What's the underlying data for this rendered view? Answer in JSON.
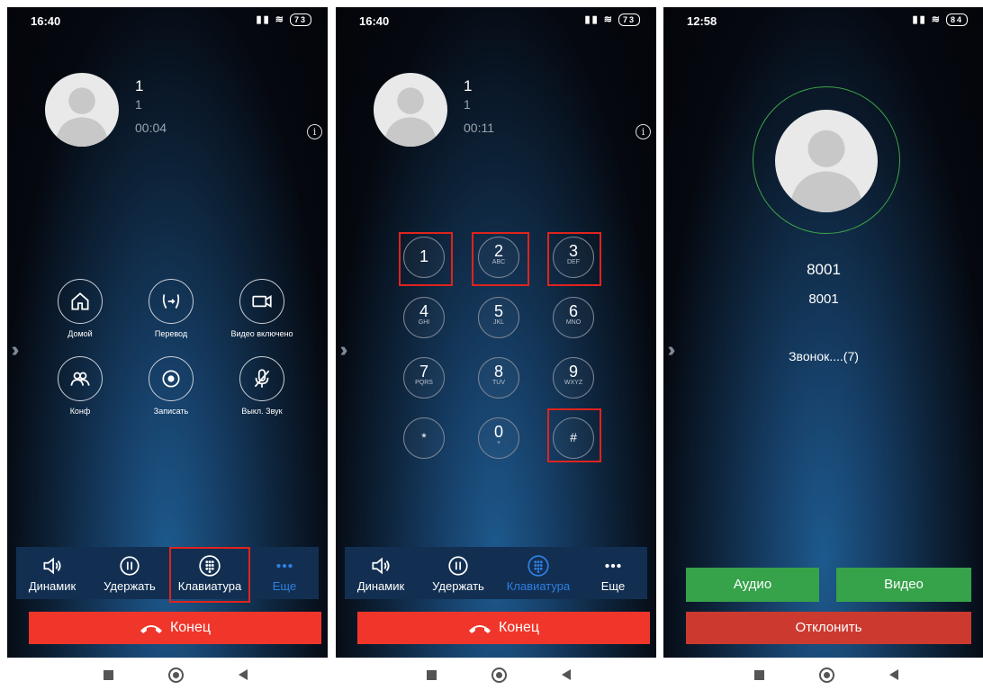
{
  "screens": [
    {
      "status_time": "16:40",
      "battery": "73",
      "caller_name": "1",
      "caller_number": "1",
      "duration": "00:04",
      "actions": [
        {
          "label": "Домой",
          "icon": "home-icon"
        },
        {
          "label": "Перевод",
          "icon": "transfer-icon"
        },
        {
          "label": "Видео включено",
          "icon": "video-icon"
        },
        {
          "label": "Конф",
          "icon": "conference-icon"
        },
        {
          "label": "Записать",
          "icon": "record-icon"
        },
        {
          "label": "Выкл. Звук",
          "icon": "mute-icon"
        }
      ],
      "bottom": [
        "Динамик",
        "Удержать",
        "Клавиатура",
        "Еще"
      ],
      "end_label": "Конец"
    },
    {
      "status_time": "16:40",
      "battery": "73",
      "caller_name": "1",
      "caller_number": "1",
      "duration": "00:11",
      "keys": [
        {
          "digit": "1",
          "letters": ""
        },
        {
          "digit": "2",
          "letters": "ABC"
        },
        {
          "digit": "3",
          "letters": "DEF"
        },
        {
          "digit": "4",
          "letters": "GHI"
        },
        {
          "digit": "5",
          "letters": "JKL"
        },
        {
          "digit": "6",
          "letters": "MNO"
        },
        {
          "digit": "7",
          "letters": "PQRS"
        },
        {
          "digit": "8",
          "letters": "TUV"
        },
        {
          "digit": "9",
          "letters": "WXYZ"
        },
        {
          "digit": "*",
          "letters": ""
        },
        {
          "digit": "0",
          "letters": "+"
        },
        {
          "digit": "#",
          "letters": ""
        }
      ],
      "bottom": [
        "Динамик",
        "Удержать",
        "Клавиатура",
        "Еще"
      ],
      "end_label": "Конец"
    },
    {
      "status_time": "12:58",
      "battery": "84",
      "caller_name": "8001",
      "caller_number": "8001",
      "call_status": "Звонок....(7)",
      "audio_label": "Аудио",
      "video_label": "Видео",
      "decline_label": "Отклонить"
    }
  ],
  "colors": {
    "end_red": "#f0362a",
    "decline_red": "#cc3a2f",
    "accept_green": "#36a24a",
    "active_blue": "#2e7fe0",
    "highlight_red": "#e0231d"
  }
}
